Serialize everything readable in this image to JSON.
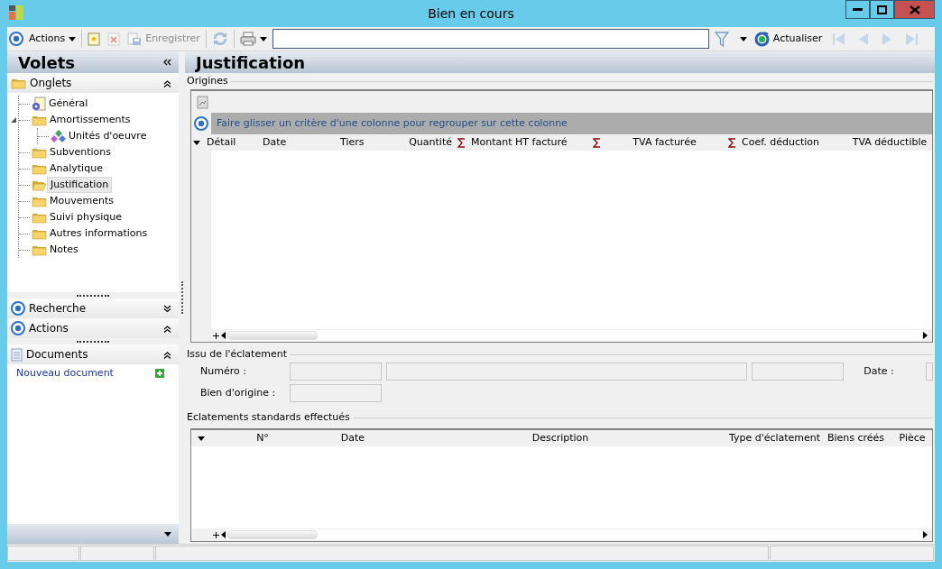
{
  "window": {
    "title": "Bien en cours"
  },
  "toolbar": {
    "items": [
      {
        "kind": "menu",
        "label": "Actions",
        "disabled": false
      },
      {
        "kind": "new",
        "disabled": false
      },
      {
        "kind": "delete",
        "disabled": true
      },
      {
        "kind": "save",
        "label": "Enregistrer",
        "disabled": true
      },
      {
        "kind": "sync",
        "disabled": true
      },
      {
        "kind": "print",
        "disabled": false
      },
      {
        "kind": "search"
      },
      {
        "kind": "filter",
        "disabled": false
      },
      {
        "kind": "refresh",
        "label": "Actualiser",
        "disabled": false
      },
      {
        "kind": "first",
        "disabled": true
      },
      {
        "kind": "prev",
        "disabled": true
      },
      {
        "kind": "next",
        "disabled": true
      },
      {
        "kind": "last",
        "disabled": true
      }
    ]
  },
  "sidebar": {
    "title": "Volets",
    "sections": [
      {
        "title": "Onglets",
        "kind": "tree",
        "expanded": true,
        "items": [
          {
            "label": "Général",
            "kind": "document",
            "selected": false
          },
          {
            "label": "Amortissements",
            "kind": "folder",
            "selected": false,
            "expanded": true,
            "children": [
              {
                "label": "Unités d'oeuvre",
                "kind": "diamonds",
                "selected": false
              }
            ]
          },
          {
            "label": "Subventions",
            "kind": "folder",
            "selected": false
          },
          {
            "label": "Analytique",
            "kind": "folder",
            "selected": false
          },
          {
            "label": "Justification",
            "kind": "folder",
            "selected": true
          },
          {
            "label": "Mouvements",
            "kind": "folder",
            "selected": false
          },
          {
            "label": "Suivi physique",
            "kind": "folder",
            "selected": false
          },
          {
            "label": "Autres informations",
            "kind": "folder",
            "selected": false
          },
          {
            "label": "Notes",
            "kind": "folder",
            "selected": false
          }
        ]
      },
      {
        "title": "Recherche",
        "kind": "panel",
        "expanded": false
      },
      {
        "title": "Actions",
        "kind": "panel",
        "expanded": true
      },
      {
        "title": "Documents",
        "kind": "links",
        "expanded": true,
        "links": [
          {
            "label": "Nouveau document"
          }
        ]
      }
    ]
  },
  "main": {
    "title": "Justification",
    "origines": {
      "legend": "Origines",
      "group_hint": "Faire glisser un critère d'une colonne pour regrouper sur cette colonne",
      "columns": [
        {
          "label": "Détail",
          "sum": false
        },
        {
          "label": "Date",
          "sum": false
        },
        {
          "label": "Tiers",
          "sum": false
        },
        {
          "label": "Quantité",
          "sum": false
        },
        {
          "label": "Montant HT facturé",
          "sum": true
        },
        {
          "label": "TVA facturée",
          "sum": true
        },
        {
          "label": "Coef. déduction",
          "sum": true
        },
        {
          "label": "TVA déductible",
          "sum": false
        }
      ]
    },
    "issu": {
      "legend": "Issu de l'éclatement",
      "numero_label": "Numéro :",
      "date_label": "Date :",
      "origin_label": "Bien d'origine :"
    },
    "eclatements": {
      "legend": "Eclatements standards effectués",
      "columns": [
        {
          "label": "N°"
        },
        {
          "label": "Date"
        },
        {
          "label": "Description"
        },
        {
          "label": "Type d'éclatement"
        },
        {
          "label": "Biens créés"
        },
        {
          "label": "Pièce"
        }
      ]
    }
  }
}
